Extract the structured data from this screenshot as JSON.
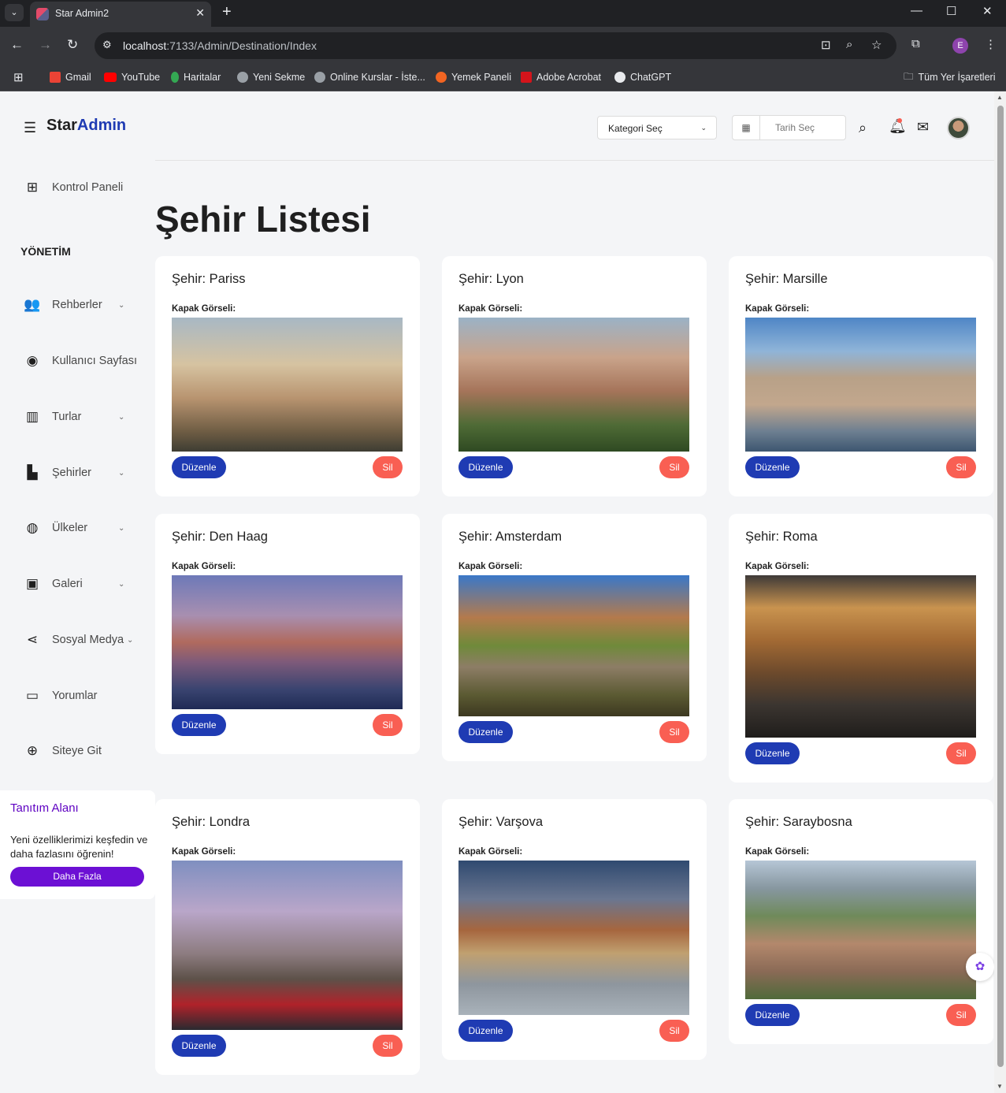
{
  "browser": {
    "tab_title": "Star Admin2",
    "url_host": "localhost",
    "url_rest": ":7133/Admin/Destination/Index",
    "profile_initial": "E",
    "bookmarks": [
      "Gmail",
      "YouTube",
      "Haritalar",
      "Yeni Sekme",
      "Online Kurslar - İste...",
      "Yemek Paneli",
      "Adobe Acrobat",
      "ChatGPT"
    ],
    "all_bookmarks": "Tüm Yer İşaretleri"
  },
  "app": {
    "logo_part1": "Star",
    "logo_part2": "Admin",
    "page_title": "Şehir Listesi",
    "category_select": "Kategori Seç",
    "date_placeholder": "Tarih Seç"
  },
  "sidebar": {
    "dashboard": "Kontrol Paneli",
    "section": "YÖNETİM",
    "items": [
      {
        "label": "Rehberler",
        "icon": "users-icon"
      },
      {
        "label": "Kullanıcı Sayfası",
        "icon": "user-circle-icon"
      },
      {
        "label": "Turlar",
        "icon": "map-icon"
      },
      {
        "label": "Şehirler",
        "icon": "city-icon"
      },
      {
        "label": "Ülkeler",
        "icon": "globe-icon"
      },
      {
        "label": "Galeri",
        "icon": "image-icon"
      },
      {
        "label": "Sosyal Medya",
        "icon": "share-icon"
      },
      {
        "label": "Yorumlar",
        "icon": "comments-icon"
      },
      {
        "label": "Siteye Git",
        "icon": "web-icon"
      }
    ],
    "promo": {
      "title": "Tanıtım Alanı",
      "text": "Yeni özelliklerimizi keşfedin ve daha fazlasını öğrenin!",
      "button": "Daha Fazla"
    }
  },
  "cards_common": {
    "image_label": "Kapak Görseli:",
    "edit": "Düzenle",
    "delete": "Sil"
  },
  "cities": [
    {
      "title": "Şehir: Pariss"
    },
    {
      "title": "Şehir: Lyon"
    },
    {
      "title": "Şehir: Marsille"
    },
    {
      "title": "Şehir: Den Haag"
    },
    {
      "title": "Şehir: Amsterdam"
    },
    {
      "title": "Şehir: Roma"
    },
    {
      "title": "Şehir: Londra"
    },
    {
      "title": "Şehir: Varşova"
    },
    {
      "title": "Şehir: Saraybosna"
    }
  ],
  "colors": {
    "primary": "#1f3bb3",
    "danger": "#f95f53",
    "promo": "#6c10d4"
  }
}
